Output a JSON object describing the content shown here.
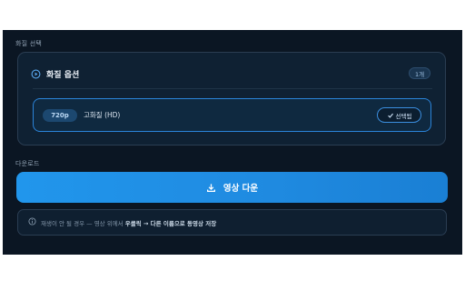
{
  "quality_section": {
    "label": "화질 선택",
    "card": {
      "title": "화질 옵션",
      "count_badge": "1개",
      "option": {
        "resolution": "720p",
        "label": "고화질 (HD)",
        "selected_label": "선택됨",
        "selected": true
      }
    }
  },
  "download_section": {
    "label": "다운로드",
    "button_label": "영상 다운"
  },
  "notice": {
    "prefix": "재생이 안 될 경우 — 영상 위에서 ",
    "emphasis": "우클릭 → 다른 이름으로 동영상 저장"
  },
  "colors": {
    "background": "#0b1623",
    "accent": "#2196ec",
    "card_border": "#2a3d52",
    "selected_border": "#2b84d9"
  },
  "icons": {
    "card_title": "play-circle-icon",
    "selected": "check-icon",
    "download": "download-icon",
    "notice": "info-icon"
  }
}
